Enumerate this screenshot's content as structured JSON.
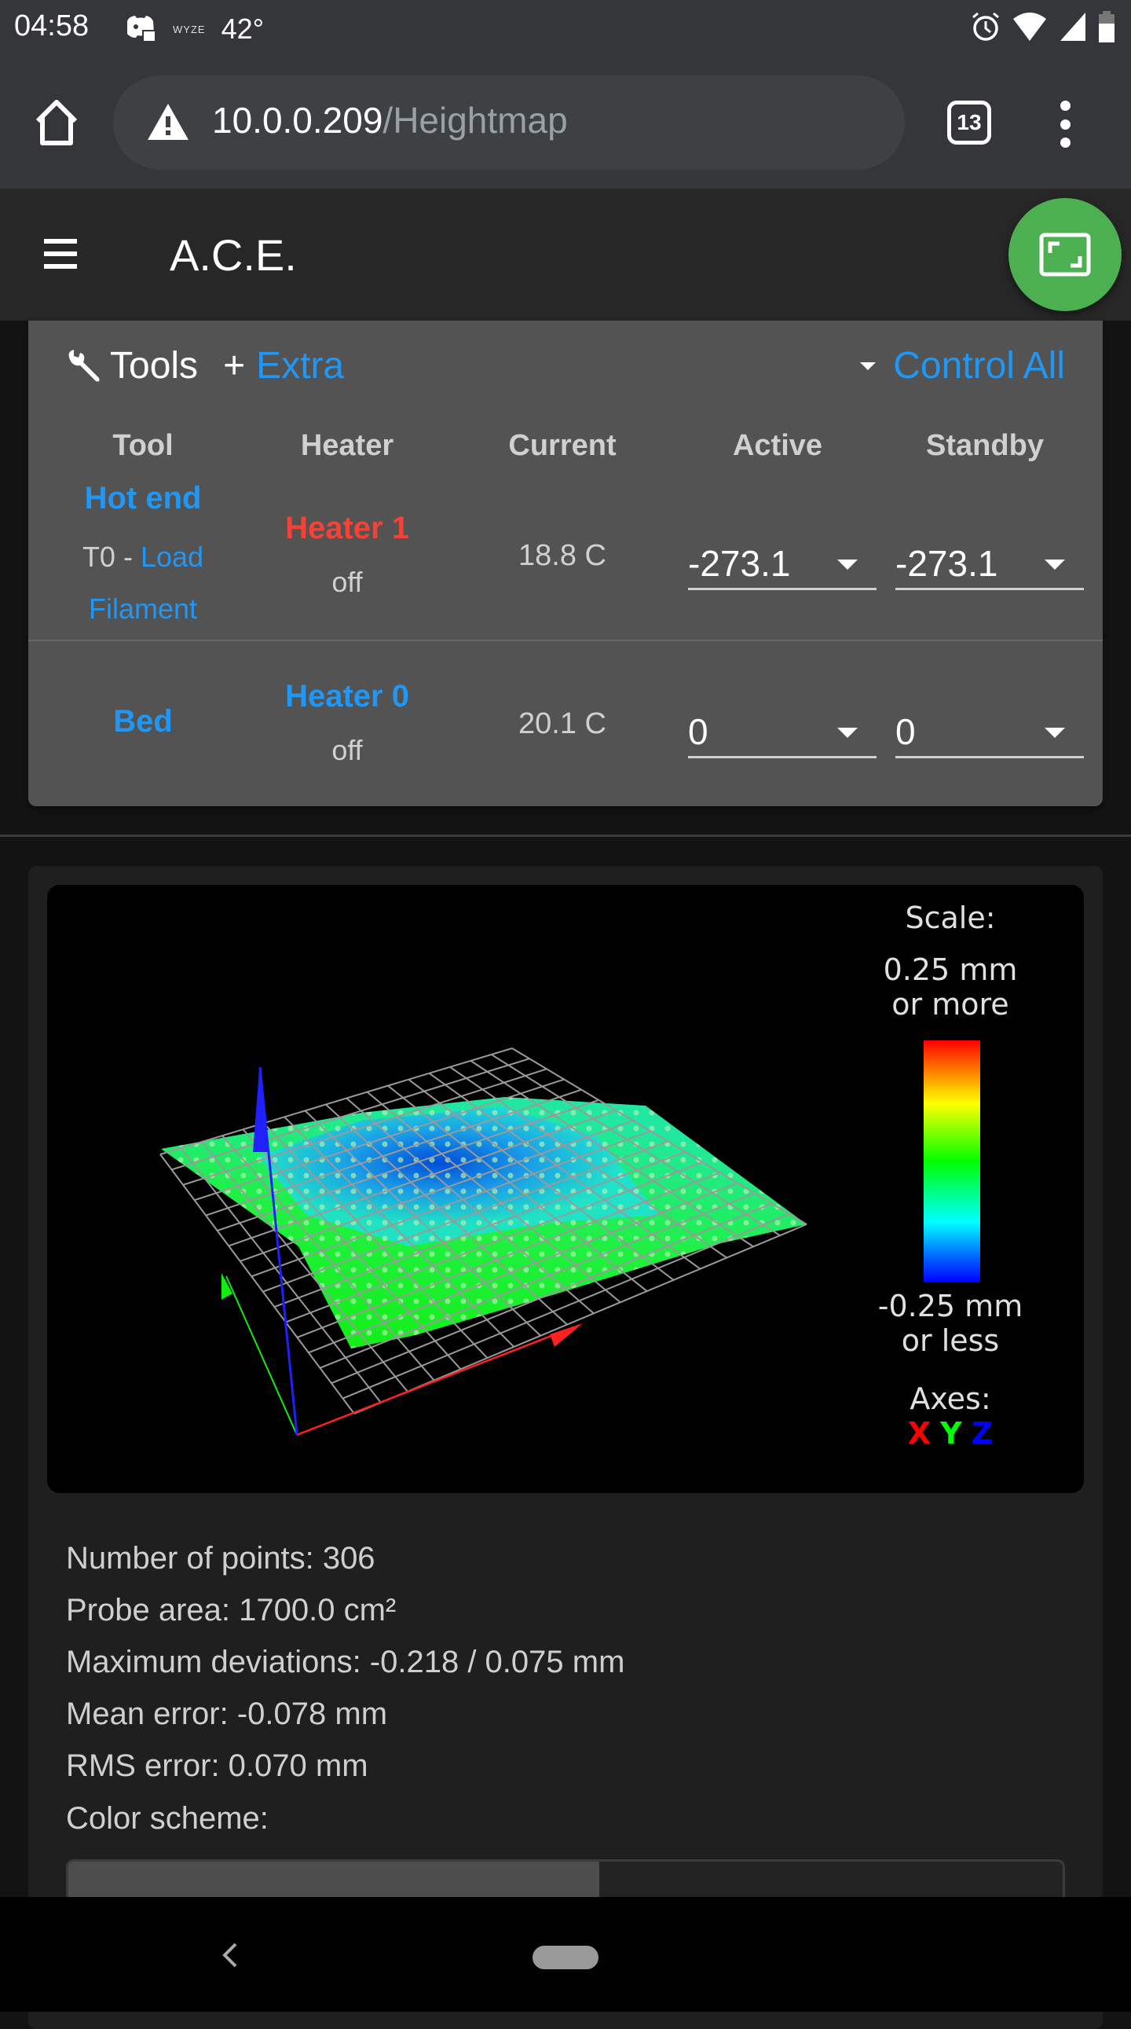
{
  "status_bar": {
    "time": "04:58",
    "notification_icons": [
      "discord-icon",
      "wyze-icon"
    ],
    "wyze_label": "WYZE",
    "temperature": "42°",
    "right_icons": [
      "alarm-icon",
      "wifi-icon",
      "signal-icon",
      "battery-icon"
    ]
  },
  "browser": {
    "url_host": "10.0.0.209",
    "url_path": "/Heightmap",
    "tab_count": "13",
    "security_icon": "warning-icon"
  },
  "app_bar": {
    "title": "A.C.E.",
    "menu_icon": "hamburger-icon",
    "fab_icon": "fullscreen-icon"
  },
  "tools_panel": {
    "title": "Tools",
    "extra_plus": "+",
    "extra_label": "Extra",
    "control_all_label": "Control All",
    "columns": [
      "Tool",
      "Heater",
      "Current",
      "Active",
      "Standby"
    ],
    "rows": [
      {
        "tool_name": "Hot end",
        "tool_prefix": "T0 - ",
        "tool_action_line1": "Load",
        "tool_action_line2": "Filament",
        "heater_name": "Heater 1",
        "heater_color": "#f44336",
        "heater_state": "off",
        "current": "18.8 C",
        "active": "-273.1",
        "standby": "-273.1"
      },
      {
        "tool_name": "Bed",
        "heater_name": "Heater 0",
        "heater_color": "#2196f3",
        "heater_state": "off",
        "current": "20.1 C",
        "active": "0",
        "standby": "0"
      }
    ]
  },
  "heightmap": {
    "legend": {
      "scale_title": "Scale:",
      "max_label_1": "0.25 mm",
      "max_label_2": "or more",
      "min_label_1": "-0.25 mm",
      "min_label_2": "or less",
      "axes_title": "Axes:",
      "axes": [
        {
          "label": "X",
          "color": "#ff0000"
        },
        {
          "label": "Y",
          "color": "#00ff00"
        },
        {
          "label": "Z",
          "color": "#0000ff"
        }
      ]
    },
    "stats": {
      "points": "Number of points: 306",
      "area": "Probe area: 1700.0 cm²",
      "max_dev": "Maximum deviations: -0.218 / 0.075 mm",
      "mean": "Mean error: -0.078 mm",
      "rms": "RMS error: 0.070 mm"
    },
    "color_scheme_label": "Color scheme:"
  },
  "colors": {
    "accent": "#2196f3",
    "fab": "#4caf50",
    "danger": "#f44336"
  }
}
